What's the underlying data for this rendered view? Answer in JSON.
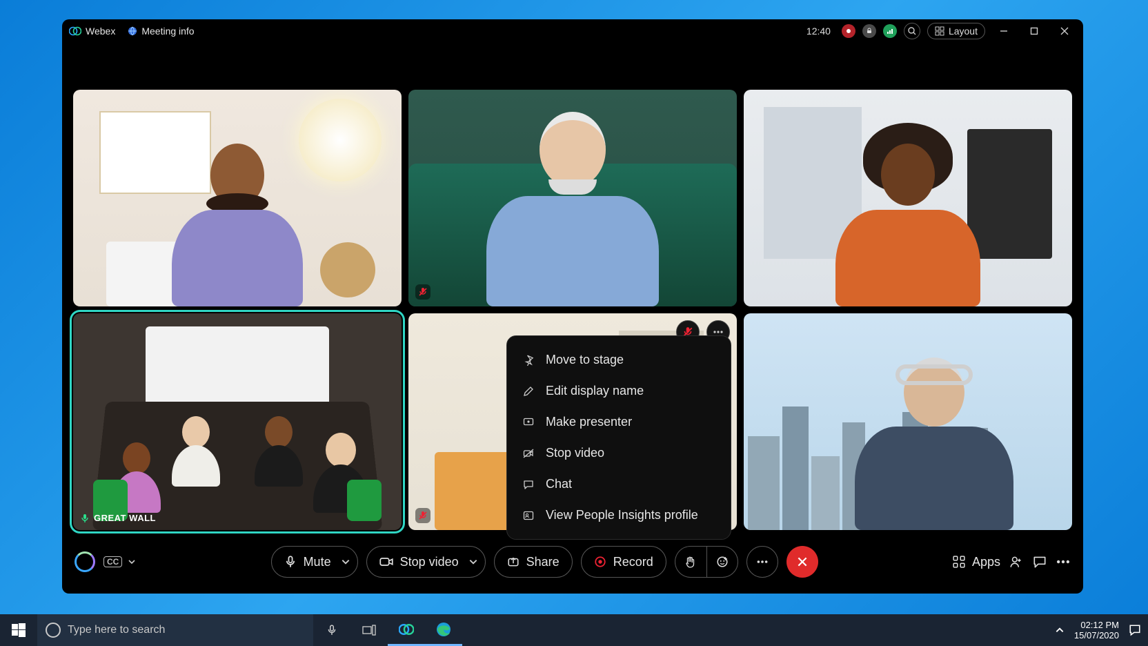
{
  "titlebar": {
    "app_name": "Webex",
    "meeting_info_label": "Meeting info",
    "elapsed": "12:40",
    "layout_label": "Layout"
  },
  "participants": [
    {
      "muted": false,
      "label": ""
    },
    {
      "muted": true,
      "label": ""
    },
    {
      "muted": false,
      "label": ""
    },
    {
      "muted": false,
      "label": "GREAT WALL",
      "selected": true,
      "mic_on": true
    },
    {
      "muted": true,
      "label": "",
      "has_menu": true
    },
    {
      "muted": false,
      "label": ""
    }
  ],
  "context_menu": {
    "items": [
      {
        "icon": "pin-icon",
        "label": "Move to stage"
      },
      {
        "icon": "pencil-icon",
        "label": "Edit display name"
      },
      {
        "icon": "presenter-icon",
        "label": "Make presenter"
      },
      {
        "icon": "camera-off-icon",
        "label": "Stop video"
      },
      {
        "icon": "chat-icon",
        "label": "Chat"
      },
      {
        "icon": "profile-icon",
        "label": "View People Insights profile"
      }
    ]
  },
  "controls": {
    "mute_label": "Mute",
    "stop_video_label": "Stop video",
    "share_label": "Share",
    "record_label": "Record",
    "apps_label": "Apps",
    "cc_label": "CC"
  },
  "taskbar": {
    "search_placeholder": "Type here to search",
    "time": "02:12 PM",
    "date": "15/07/2020"
  }
}
